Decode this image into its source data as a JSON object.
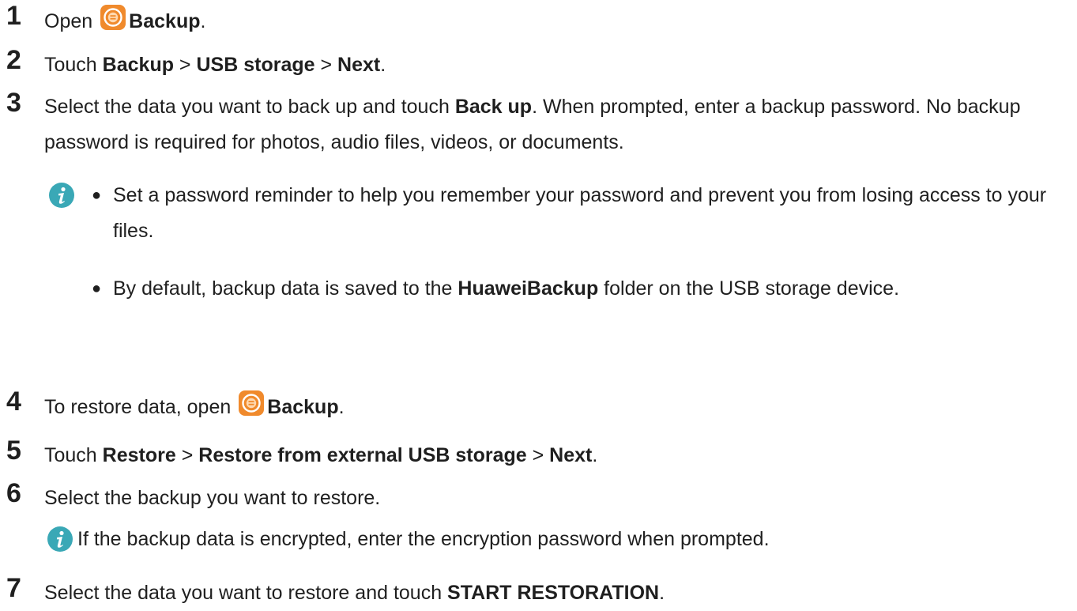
{
  "steps": [
    {
      "num": "1",
      "parts": [
        {
          "t": "Open",
          "b": false
        },
        {
          "icon": "backup-app-icon"
        },
        {
          "t": "Backup",
          "b": true
        },
        {
          "t": ".",
          "b": false
        }
      ]
    },
    {
      "num": "2",
      "parts": [
        {
          "t": "Touch ",
          "b": false
        },
        {
          "t": "Backup",
          "b": true
        },
        {
          "t": " > ",
          "b": false
        },
        {
          "t": "USB storage",
          "b": true
        },
        {
          "t": " > ",
          "b": false
        },
        {
          "t": "Next",
          "b": true
        },
        {
          "t": ".",
          "b": false
        }
      ]
    },
    {
      "num": "3",
      "parts": [
        {
          "t": "Select the data you want to back up and touch ",
          "b": false
        },
        {
          "t": "Back up",
          "b": true
        },
        {
          "t": ". When prompted, enter a backup password. No backup password is required for photos, audio files, videos, or documents.",
          "b": false
        }
      ]
    },
    {
      "num": "4",
      "parts": [
        {
          "t": "To restore data, open",
          "b": false
        },
        {
          "icon": "backup-app-icon"
        },
        {
          "t": "Backup",
          "b": true
        },
        {
          "t": ".",
          "b": false
        }
      ]
    },
    {
      "num": "5",
      "parts": [
        {
          "t": "Touch ",
          "b": false
        },
        {
          "t": "Restore",
          "b": true
        },
        {
          "t": " > ",
          "b": false
        },
        {
          "t": "Restore from external USB storage",
          "b": true
        },
        {
          "t": " > ",
          "b": false
        },
        {
          "t": "Next",
          "b": true
        },
        {
          "t": ".",
          "b": false
        }
      ]
    },
    {
      "num": "6",
      "parts": [
        {
          "t": "Select the backup you want to restore.",
          "b": false
        }
      ]
    },
    {
      "num": "7",
      "parts": [
        {
          "t": "Select the data you want to restore and touch ",
          "b": false
        },
        {
          "t": "START RESTORATION",
          "b": true
        },
        {
          "t": ".",
          "b": false
        }
      ]
    }
  ],
  "note_step3": {
    "icon": "info-icon",
    "bullets": [
      [
        {
          "t": "Set a password reminder to help you remember your password and prevent you from losing access to your files.",
          "b": false
        }
      ],
      [
        {
          "t": "By default, backup data is saved to the ",
          "b": false
        },
        {
          "t": "HuaweiBackup",
          "b": true
        },
        {
          "t": " folder on the USB storage device.",
          "b": false
        }
      ]
    ]
  },
  "note_step6": {
    "icon": "info-icon",
    "text": "If the backup data is encrypted, enter the encryption password when prompted."
  },
  "colors": {
    "text": "#1f1f1f",
    "info_icon": "#3aa8b6",
    "backup_icon_outer": "#f08a2c",
    "backup_icon_inner": "#ffd9b0"
  }
}
